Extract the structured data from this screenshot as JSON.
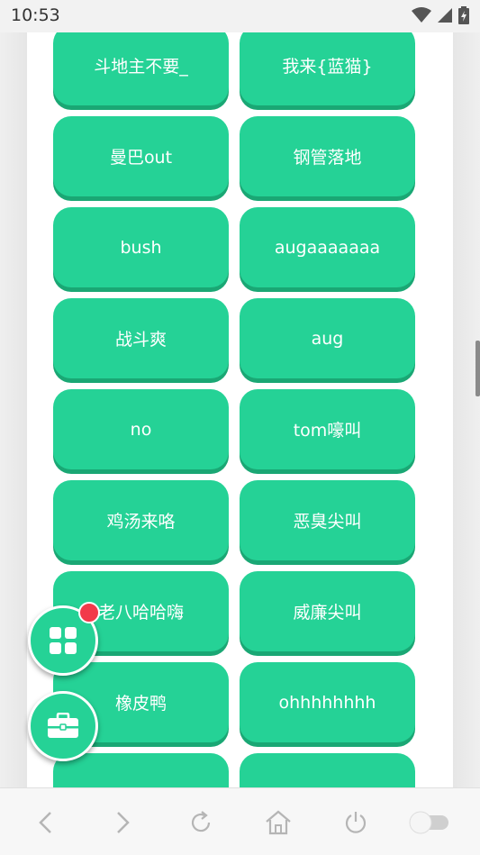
{
  "status_bar": {
    "time": "10:53"
  },
  "sound_buttons": [
    "斗地主不要_",
    "我来{蓝猫}",
    "曼巴out",
    "钢管落地",
    "bush",
    "augaaaaaaa",
    "战斗爽",
    "aug",
    "no",
    "tom嚎叫",
    "鸡汤来咯",
    "恶臭尖叫",
    "老八哈哈嗨",
    "威廉尖叫",
    "橡皮鸭",
    "ohhhhhhhh",
    "",
    ""
  ],
  "colors": {
    "accent": "#25d296",
    "badge": "#f23a4a"
  },
  "icons": {
    "fab_apps": "grid-apps-icon",
    "fab_tools": "toolbox-icon",
    "nav": [
      "back-icon",
      "forward-icon",
      "reload-icon",
      "home-icon",
      "power-icon",
      "toggle-switch"
    ]
  }
}
